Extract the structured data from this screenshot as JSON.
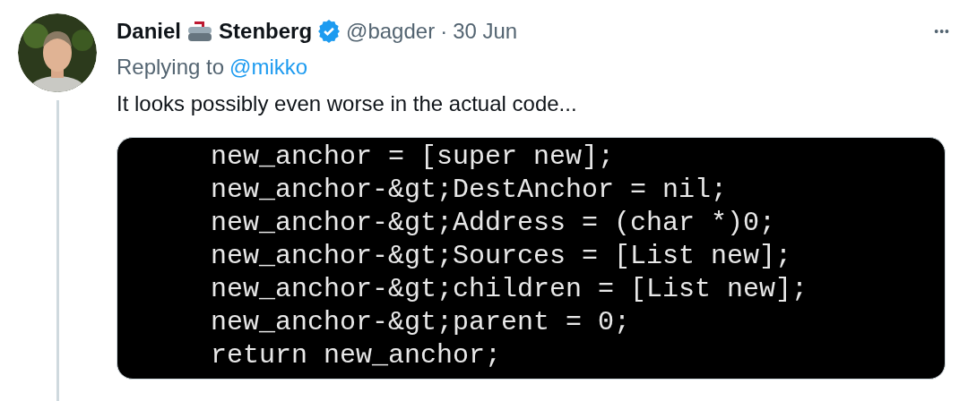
{
  "tweet": {
    "author": {
      "name_first": "Daniel",
      "name_last": "Stenberg",
      "handle": "@bagder",
      "separator": "·",
      "date": "30 Jun",
      "verified": true
    },
    "more": "•••",
    "replying_label": "Replying to",
    "replying_to": "@mikko",
    "text": "It looks possibly even worse in the actual code...",
    "code_lines": [
      "new_anchor = [super new];",
      "new_anchor-&gt;DestAnchor = nil;",
      "new_anchor-&gt;Address = (char *)0;",
      "new_anchor-&gt;Sources = [List new];",
      "new_anchor-&gt;children = [List new];",
      "new_anchor-&gt;parent = 0;",
      "return new_anchor;"
    ]
  }
}
